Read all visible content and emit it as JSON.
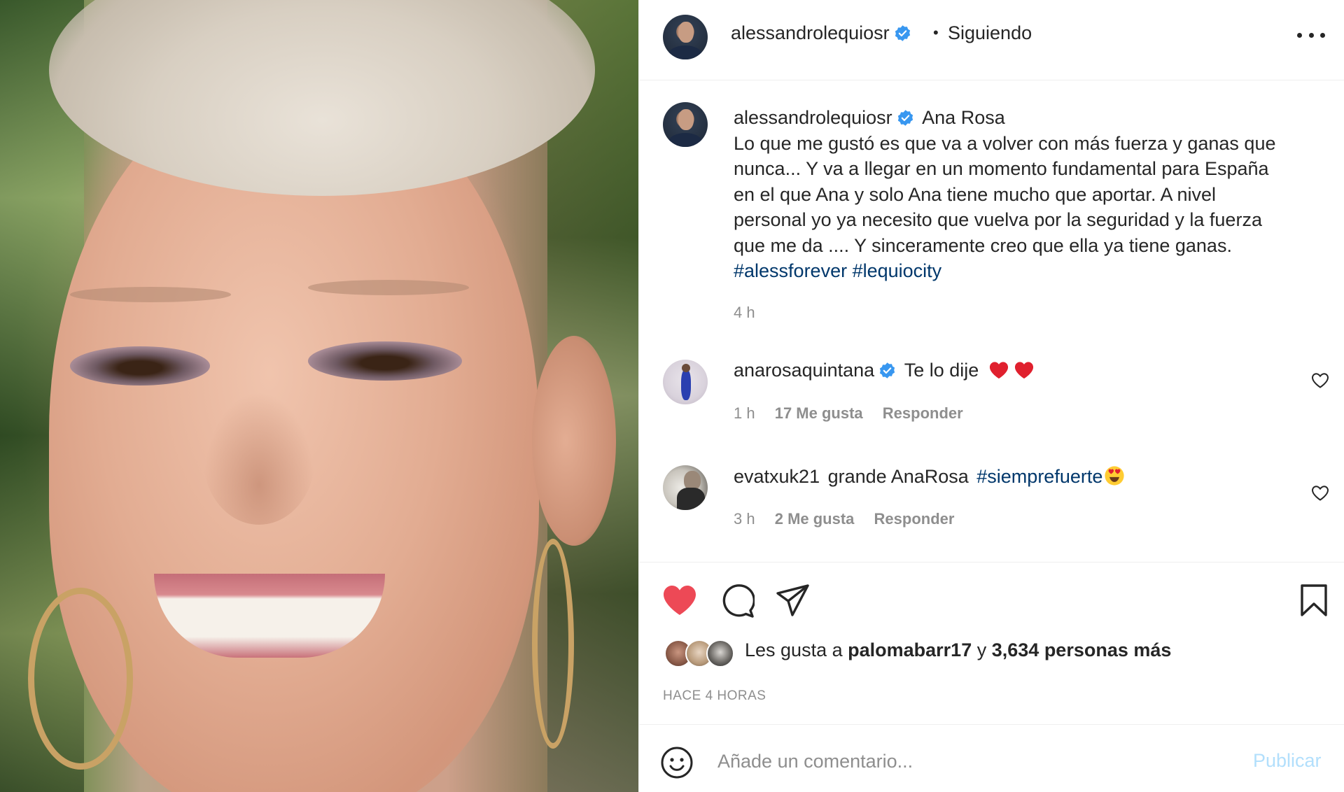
{
  "header": {
    "username": "alessandrolequiosr",
    "separator": "•",
    "follow_status": "Siguiendo"
  },
  "caption": {
    "username": "alessandrolequiosr",
    "mention": "Ana Rosa",
    "lines": [
      "Lo que me gustó es que va a volver con más fuerza y ganas que",
      "nunca... Y va a llegar en un momento fundamental para España",
      "en el que Ana y solo Ana tiene mucho que aportar. A nivel",
      "personal yo ya necesito que vuelva por la seguridad y la fuerza",
      "que me da .... Y sinceramente creo que ella ya tiene ganas."
    ],
    "hashtags": [
      "#alessforever",
      "#lequiocity"
    ],
    "time": "4 h"
  },
  "comments": [
    {
      "username": "anarosaquintana",
      "verified": true,
      "text": "Te lo dije",
      "emoji": "red-heart x2",
      "time": "1 h",
      "likes": "17 Me gusta",
      "reply": "Responder"
    },
    {
      "username": "evatxuk21",
      "verified": false,
      "text": "grande AnaRosa",
      "hashtag": "#siemprefuerte",
      "emoji": "heart-eyes",
      "time": "3 h",
      "likes": "2 Me gusta",
      "reply": "Responder"
    }
  ],
  "likes": {
    "prefix": "Les gusta a",
    "user": "palomabarr17",
    "joiner": "y",
    "others": "3,634 personas más",
    "posted_ago": "HACE 4 HORAS"
  },
  "comment_box": {
    "placeholder": "Añade un comentario...",
    "publish_label": "Publicar"
  },
  "icons": {
    "like": "heart-filled-icon",
    "comment": "comment-icon",
    "share": "paper-plane-icon",
    "save": "bookmark-icon",
    "emoji": "smiley-icon",
    "more": "more-options-icon",
    "verified": "verified-badge-icon"
  },
  "colors": {
    "like_red": "#ed4956",
    "verified_blue": "#3897f0",
    "hashtag_blue": "#00376b",
    "muted_gray": "#8e8e8e",
    "publish_disabled": "#b2dffc"
  }
}
